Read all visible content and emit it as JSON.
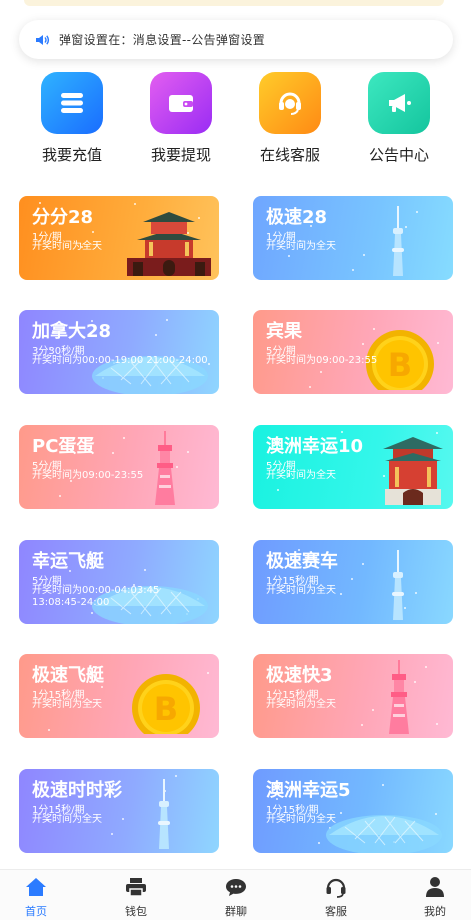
{
  "notice": {
    "text": "弹窗设置在：消息设置--公告弹窗设置"
  },
  "quick_actions": [
    {
      "label": "我要充值",
      "icon": "recharge-icon",
      "color": "#1e8dff"
    },
    {
      "label": "我要提现",
      "icon": "wallet-icon",
      "color": "#c23ff0"
    },
    {
      "label": "在线客服",
      "icon": "customer-service-icon",
      "color": "#ff9c1c"
    },
    {
      "label": "公告中心",
      "icon": "megaphone-icon",
      "color": "#1fd6b0"
    }
  ],
  "games": [
    {
      "title": "分分28",
      "period": "1分/期",
      "hours": "开奖时间为全天",
      "theme": "orange",
      "art": "palace"
    },
    {
      "title": "极速28",
      "period": "1分/期",
      "hours": "开奖时间为全天",
      "theme": "blue",
      "art": "tower"
    },
    {
      "title": "加拿大28",
      "period": "3分30秒/期",
      "hours": "开奖时间为00:00-19:00 21:00-24:00",
      "theme": "purple",
      "art": "dome"
    },
    {
      "title": "宾果",
      "period": "5分/期",
      "hours": "开奖时间为09:00-23:55",
      "theme": "peach",
      "art": "coin"
    },
    {
      "title": "PC蛋蛋",
      "period": "5分/期",
      "hours": "开奖时间为09:00-23:55",
      "theme": "peach",
      "art": "pinktower"
    },
    {
      "title": "澳洲幸运10",
      "period": "5分/期",
      "hours": "开奖时间为全天",
      "theme": "cyan",
      "art": "pagoda"
    },
    {
      "title": "幸运飞艇",
      "period": "5分/期",
      "hours": "开奖时间为00:00-04:03:45 13:08:45-24:00",
      "theme": "purple",
      "art": "dome"
    },
    {
      "title": "极速赛车",
      "period": "1分15秒/期",
      "hours": "开奖时间为全天",
      "theme": "skyblue",
      "art": "tower"
    },
    {
      "title": "极速飞艇",
      "period": "1分15秒/期",
      "hours": "开奖时间为全天",
      "theme": "peach",
      "art": "coin"
    },
    {
      "title": "极速快3",
      "period": "1分15秒/期",
      "hours": "开奖时间为全天",
      "theme": "peach",
      "art": "pinktower"
    },
    {
      "title": "极速时时彩",
      "period": "1分15秒/期",
      "hours": "开奖时间为全天",
      "theme": "purple",
      "art": "tower"
    },
    {
      "title": "澳洲幸运5",
      "period": "1分15秒/期",
      "hours": "开奖时间为全天",
      "theme": "skyblue",
      "art": "dome"
    }
  ],
  "tabbar": {
    "active": 0,
    "items": [
      {
        "label": "首页",
        "icon": "home-icon"
      },
      {
        "label": "钱包",
        "icon": "wallet-printer-icon"
      },
      {
        "label": "群聊",
        "icon": "chat-bubble-icon"
      },
      {
        "label": "客服",
        "icon": "headset-icon"
      },
      {
        "label": "我的",
        "icon": "user-icon"
      }
    ]
  }
}
